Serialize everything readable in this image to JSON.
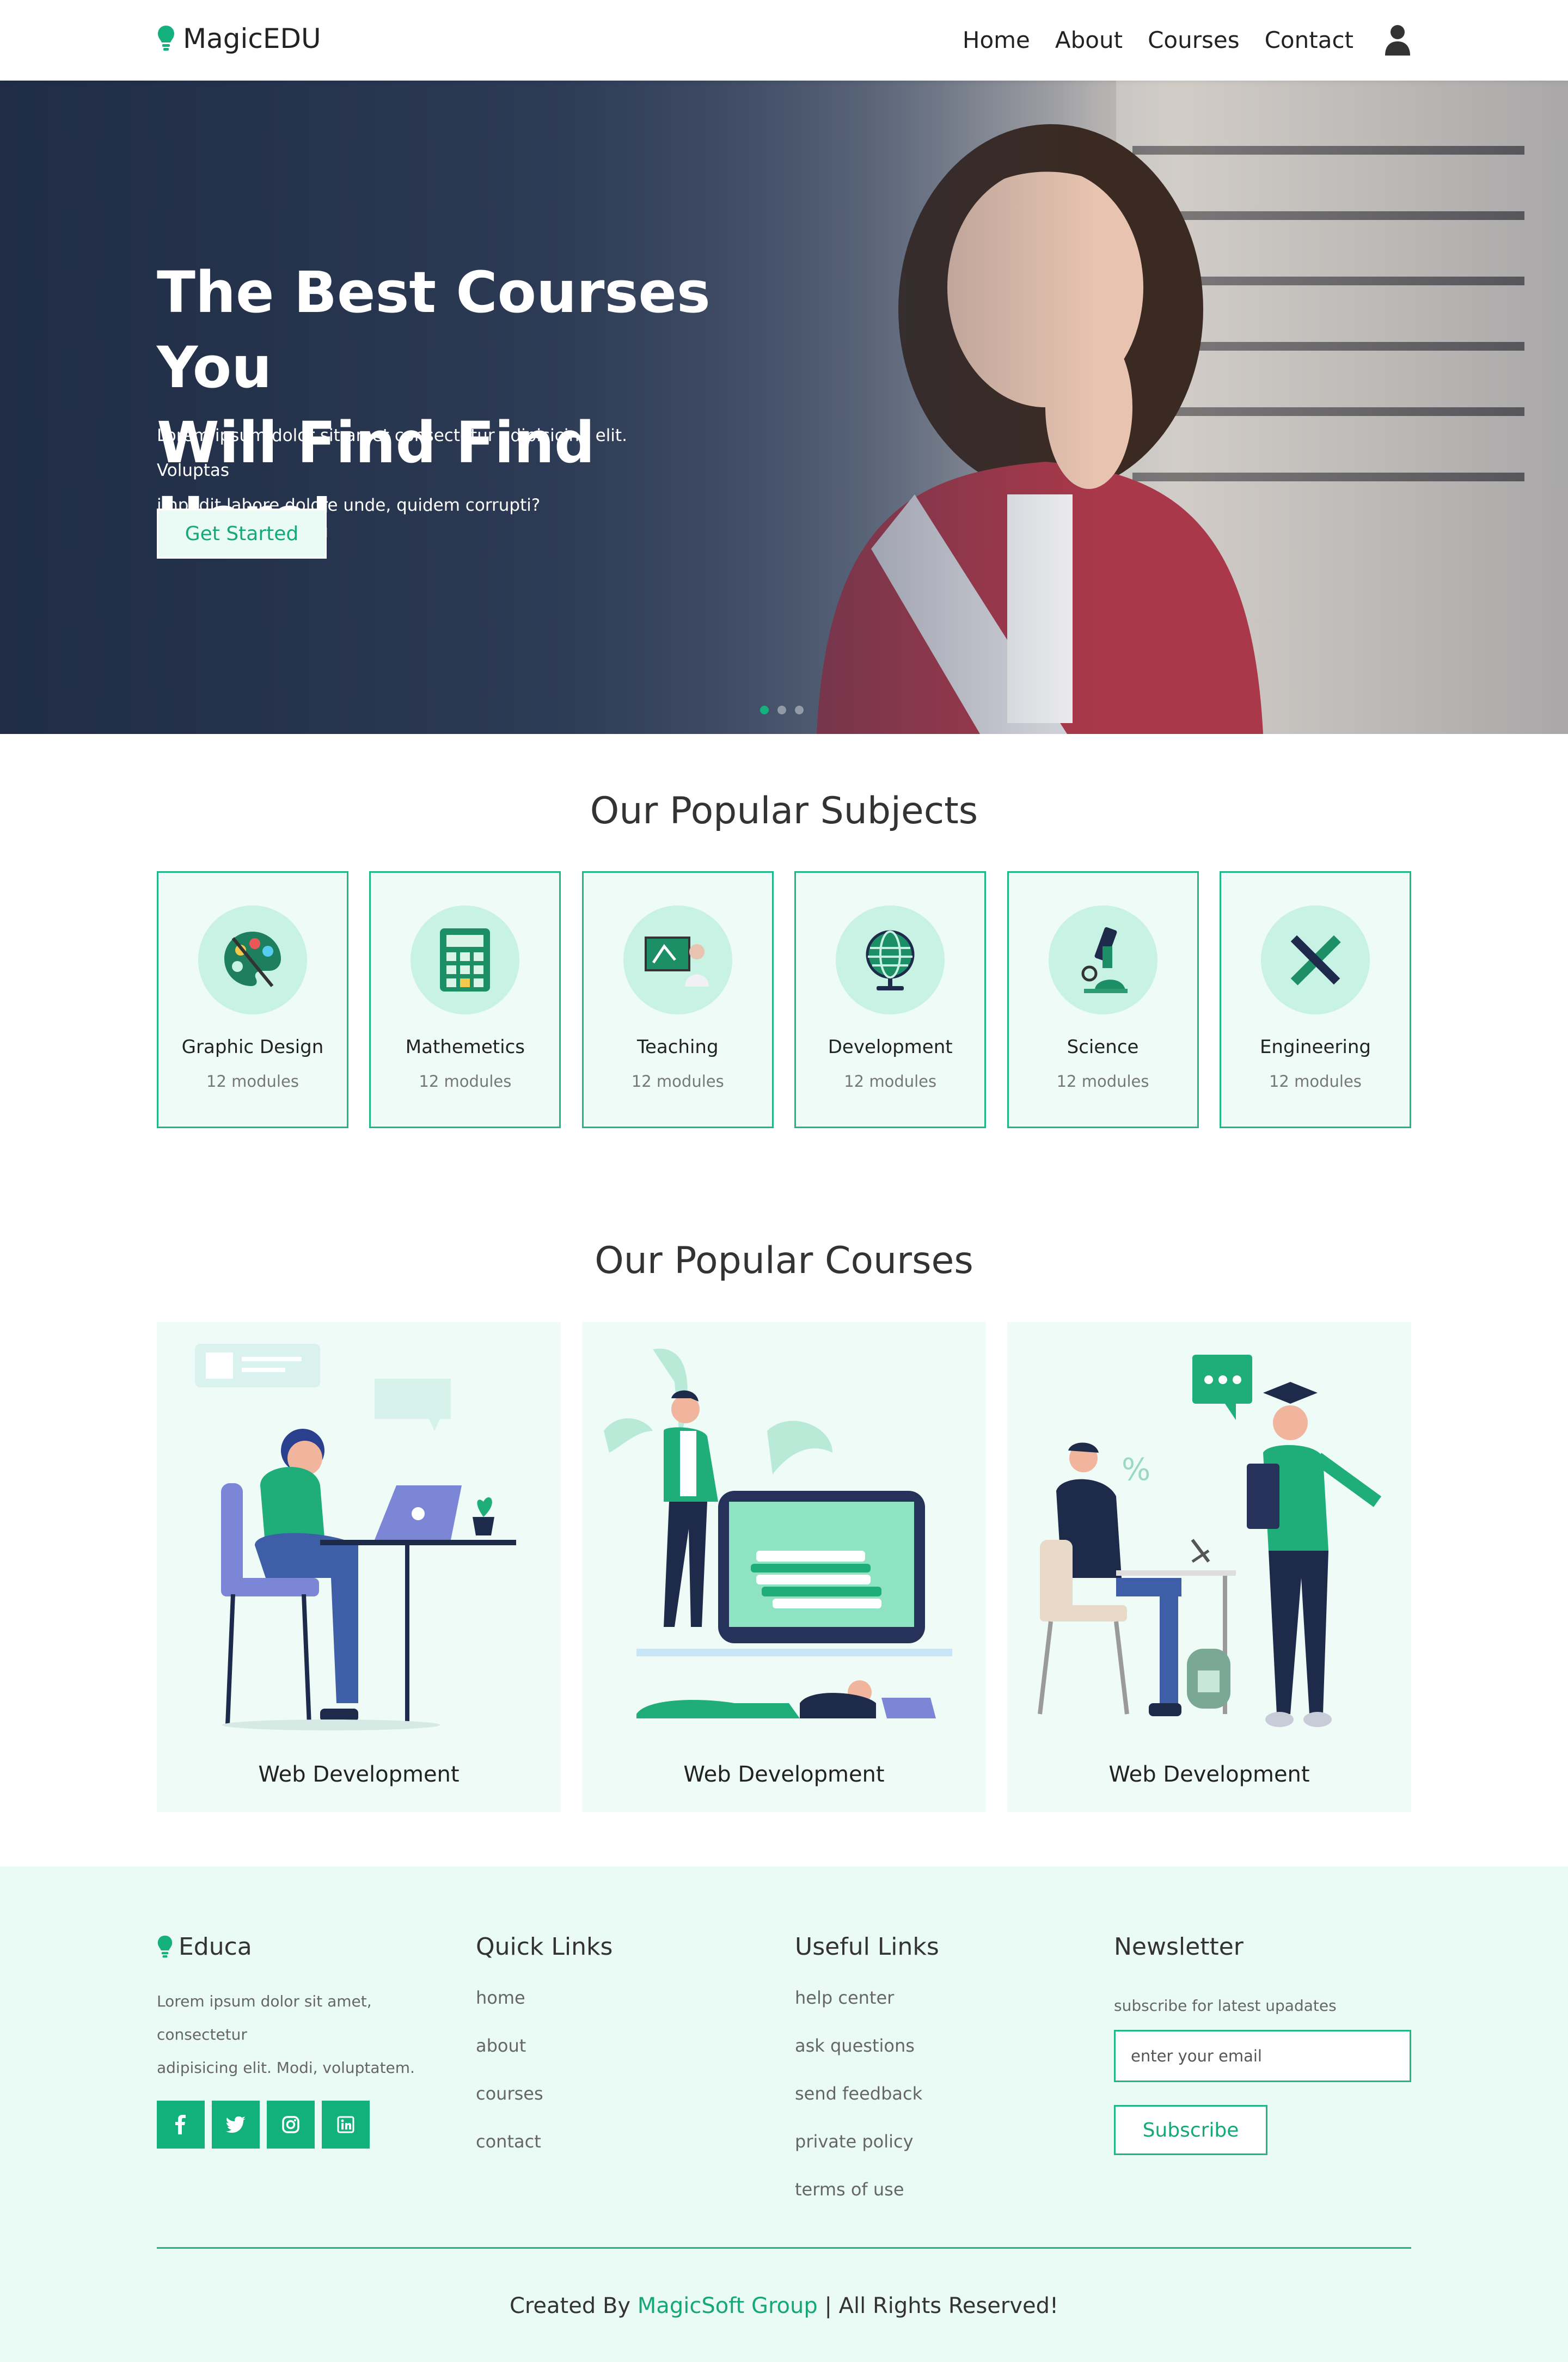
{
  "nav": {
    "brand": "MagicEDU",
    "items": [
      "Home",
      "About",
      "Courses",
      "Contact"
    ],
    "user_icon": "user-icon"
  },
  "hero": {
    "title_line1": "The Best Courses You",
    "title_line2": "Will Find Find Here!",
    "subtitle_line1": "Lorem ipsum dolor sit amet consectetur adipisicing elit. Voluptas",
    "subtitle_line2": "impedit labore dolore unde, quidem corrupti?",
    "cta": "Get Started",
    "slides": 3,
    "active_slide": 1
  },
  "subjects": {
    "title": "Our Popular Subjects",
    "items": [
      {
        "name": "Graphic Design",
        "modules": "12 modules",
        "icon": "palette-icon"
      },
      {
        "name": "Mathemetics",
        "modules": "12 modules",
        "icon": "calculator-icon"
      },
      {
        "name": "Teaching",
        "modules": "12 modules",
        "icon": "teacher-board-icon"
      },
      {
        "name": "Development",
        "modules": "12 modules",
        "icon": "globe-icon"
      },
      {
        "name": "Science",
        "modules": "12 modules",
        "icon": "microscope-icon"
      },
      {
        "name": "Engineering",
        "modules": "12 modules",
        "icon": "ruler-pencil-icon"
      }
    ]
  },
  "courses": {
    "title": "Our Popular Courses",
    "items": [
      {
        "label": "Web Development"
      },
      {
        "label": "Web Development"
      },
      {
        "label": "Web Development"
      }
    ]
  },
  "footer": {
    "brand": "Educa",
    "about_line1": "Lorem ipsum dolor sit amet, consectetur",
    "about_line2": "adipisicing elit. Modi, voluptatem.",
    "social": [
      "facebook-icon",
      "twitter-icon",
      "instagram-icon",
      "linkedin-icon"
    ],
    "quick_links_title": "Quick Links",
    "quick_links": [
      "home",
      "about",
      "courses",
      "contact"
    ],
    "useful_links_title": "Useful Links",
    "useful_links": [
      "help center",
      "ask questions",
      "send feedback",
      "private policy",
      "terms of use"
    ],
    "newsletter_title": "Newsletter",
    "newsletter_sub": "subscribe for latest upadates",
    "email_placeholder": "enter your email",
    "subscribe": "Subscribe",
    "copyright_prefix": "Created By",
    "copyright_brand": "MagicSoft Group",
    "copyright_suffix": "| All Rights Reserved!"
  },
  "colors": {
    "accent": "#14b07d",
    "light_bg": "#eafaf5",
    "card_border": "#20b788"
  }
}
